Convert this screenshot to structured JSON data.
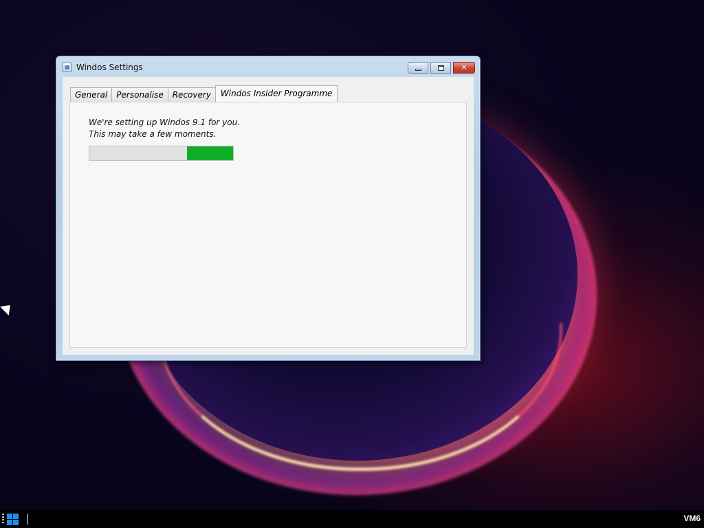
{
  "window": {
    "title": "Windos Settings",
    "title_icon": "settings-app-icon",
    "buttons": {
      "minimize": "minimize-icon",
      "maximize": "maximize-icon",
      "close": "✕"
    }
  },
  "tabs": [
    {
      "label": "General",
      "active": false
    },
    {
      "label": "Personalise",
      "active": false
    },
    {
      "label": "Recovery",
      "active": false
    },
    {
      "label": "Windos Insider Programme",
      "active": true
    }
  ],
  "content": {
    "line1": "We're setting up Windos 9.1 for you.",
    "line2": "This may take a few moments.",
    "progress_color": "#0fae26"
  },
  "taskbar": {
    "start_icon": "windows-logo-icon",
    "label": "VM6"
  }
}
